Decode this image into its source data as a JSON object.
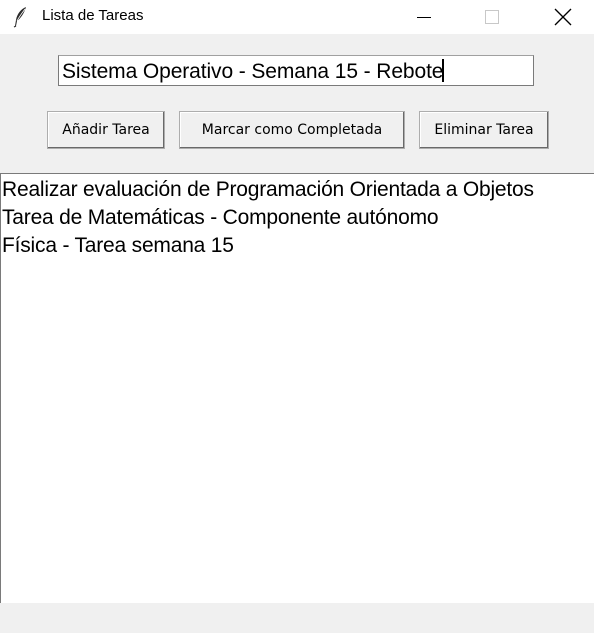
{
  "window": {
    "title": "Lista de Tareas",
    "app_icon": "feather-icon"
  },
  "entry": {
    "value": "Sistema Operativo - Semana 15 - Rebote"
  },
  "buttons": {
    "add_label": "Añadir Tarea",
    "complete_label": "Marcar como Completada",
    "delete_label": "Eliminar Tarea"
  },
  "tasks": [
    "Realizar evaluación de Programación Orientada a Objetos",
    "Tarea de Matemáticas - Componente autónomo",
    "Física - Tarea semana 15"
  ]
}
